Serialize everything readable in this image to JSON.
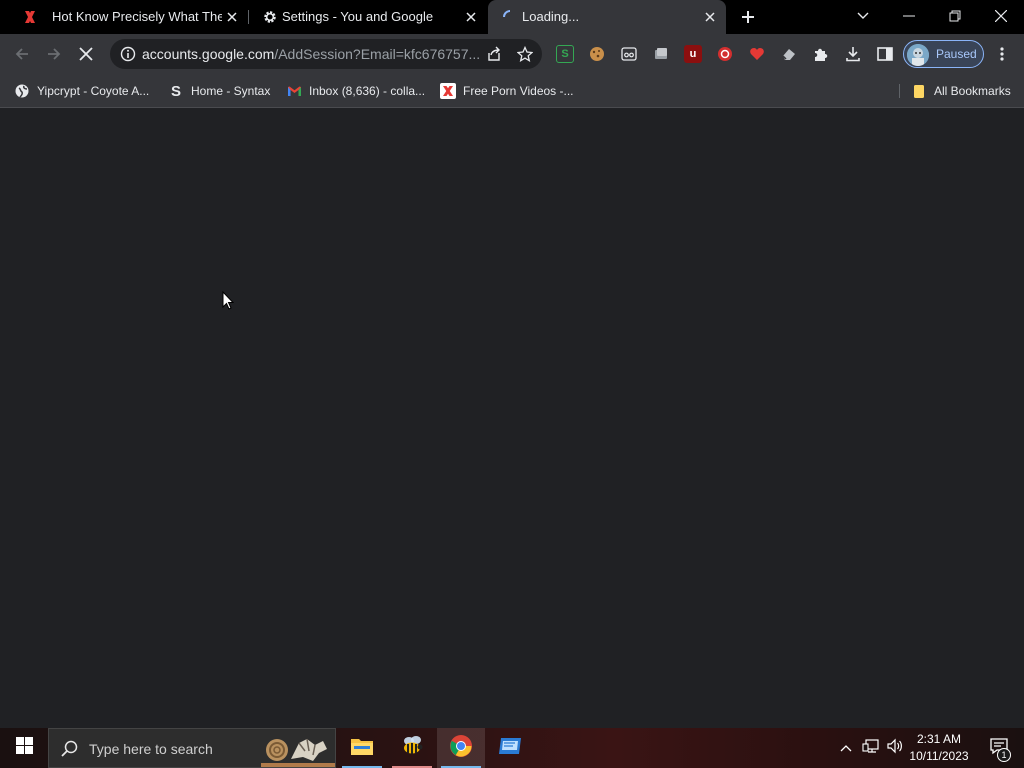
{
  "tabs": [
    {
      "title": "Hot Know Precisely What Their A",
      "favicon": "x-red-icon",
      "active": false
    },
    {
      "title": "Settings - You and Google",
      "favicon": "gear-icon",
      "active": false
    },
    {
      "title": "Loading...",
      "favicon": "spinner-icon",
      "active": true
    }
  ],
  "toolbar": {
    "url_host": "accounts.google.com",
    "url_path": "/AddSession?Email=kfc676757...",
    "profile_label": "Paused"
  },
  "bookmarks": {
    "items": [
      {
        "label": "Yipcrypt - Coyote A...",
        "icon": "globe-icon"
      },
      {
        "label": "Home - Syntax",
        "icon": "s-icon"
      },
      {
        "label": "Inbox (8,636) - colla...",
        "icon": "gmail-icon"
      },
      {
        "label": "Free Porn Videos -...",
        "icon": "x-red-icon"
      }
    ],
    "all_label": "All Bookmarks"
  },
  "taskbar": {
    "search_placeholder": "Type here to search",
    "time": "2:31 AM",
    "date": "10/11/2023",
    "notification_count": "1"
  },
  "colors": {
    "tab_bar": "#000000",
    "toolbar": "#35363a",
    "page_bg": "#202124",
    "accent": "#8ab4f8"
  }
}
